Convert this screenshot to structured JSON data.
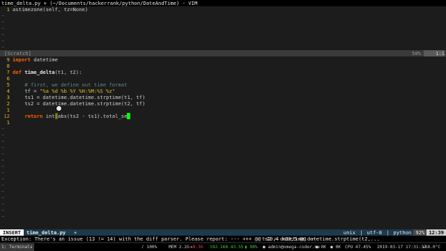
{
  "window_title": "time_delta.py + (~/Documents/hackerrank/python/DateAndTime) - VIM",
  "top_pane": {
    "lines": [
      {
        "num": "1",
        "text": "astimezone(self, tz=None)"
      }
    ],
    "tilde": "~"
  },
  "split_bar": {
    "name": "[Scratch]",
    "percent": "50%",
    "position": "1:1"
  },
  "code": {
    "l9_num": "9",
    "l9_kw": "import",
    "l9_rest": " datetime",
    "l8_num": "8",
    "l7_num": "7",
    "l7_kw": "def",
    "l7_fn": "time_delta",
    "l7_rest": "(t1, t2):",
    "l6_num": "6",
    "l5_num": "5",
    "l5_comment": "# first, we define out time format",
    "l4_num": "4",
    "l4_pre": "tf = ",
    "l4_str": "\"%a %d %b %Y %H:%M:%S %z\"",
    "l3_num": "3",
    "l3_text": "ts1 = datetime.datetime.strptime(t1, tf)",
    "l2_num": "2",
    "l2_text": "ts2 = datetime.datetime.strptime(t2, tf)",
    "l1_num": "1",
    "l12_num": "12",
    "l12_kw": "return",
    "l12_mid": " int",
    "l12_paren": "(",
    "l12_rest": "abs(ts2 - ts1).total_se",
    "l1b_num": "1",
    "tilde": "~"
  },
  "statusline": {
    "mode": "INSERT",
    "filename": "time_delta.py",
    "modified": "+",
    "format": "unix",
    "encoding": "utf-8",
    "filetype": "python",
    "percent": "92%",
    "position": "12:39"
  },
  "message": {
    "left": "Exception: There's an issue (13 != 14) with the diff parser. Please report: ---  +++  @@ -10,4 +10,5 @@ ---",
    "right": "ts2 = datetime.datetime.strptime(t2,..."
  },
  "taskbar": {
    "workspace": "1: Terminals",
    "volume": "100%",
    "mem": "MEM 2.2G",
    "disk": "8.3G",
    "ip": "192.168.43.55",
    "battery": "98%",
    "user": "admin@omega-coder.me",
    "ok1": "0K",
    "ok2": "0K",
    "cpu": "CPU 47.45%",
    "datetime": "2019-03-17 17:31:37",
    "temp": "68.0°C",
    "accent_red": "#ff4040",
    "accent_green": "#40d040"
  }
}
